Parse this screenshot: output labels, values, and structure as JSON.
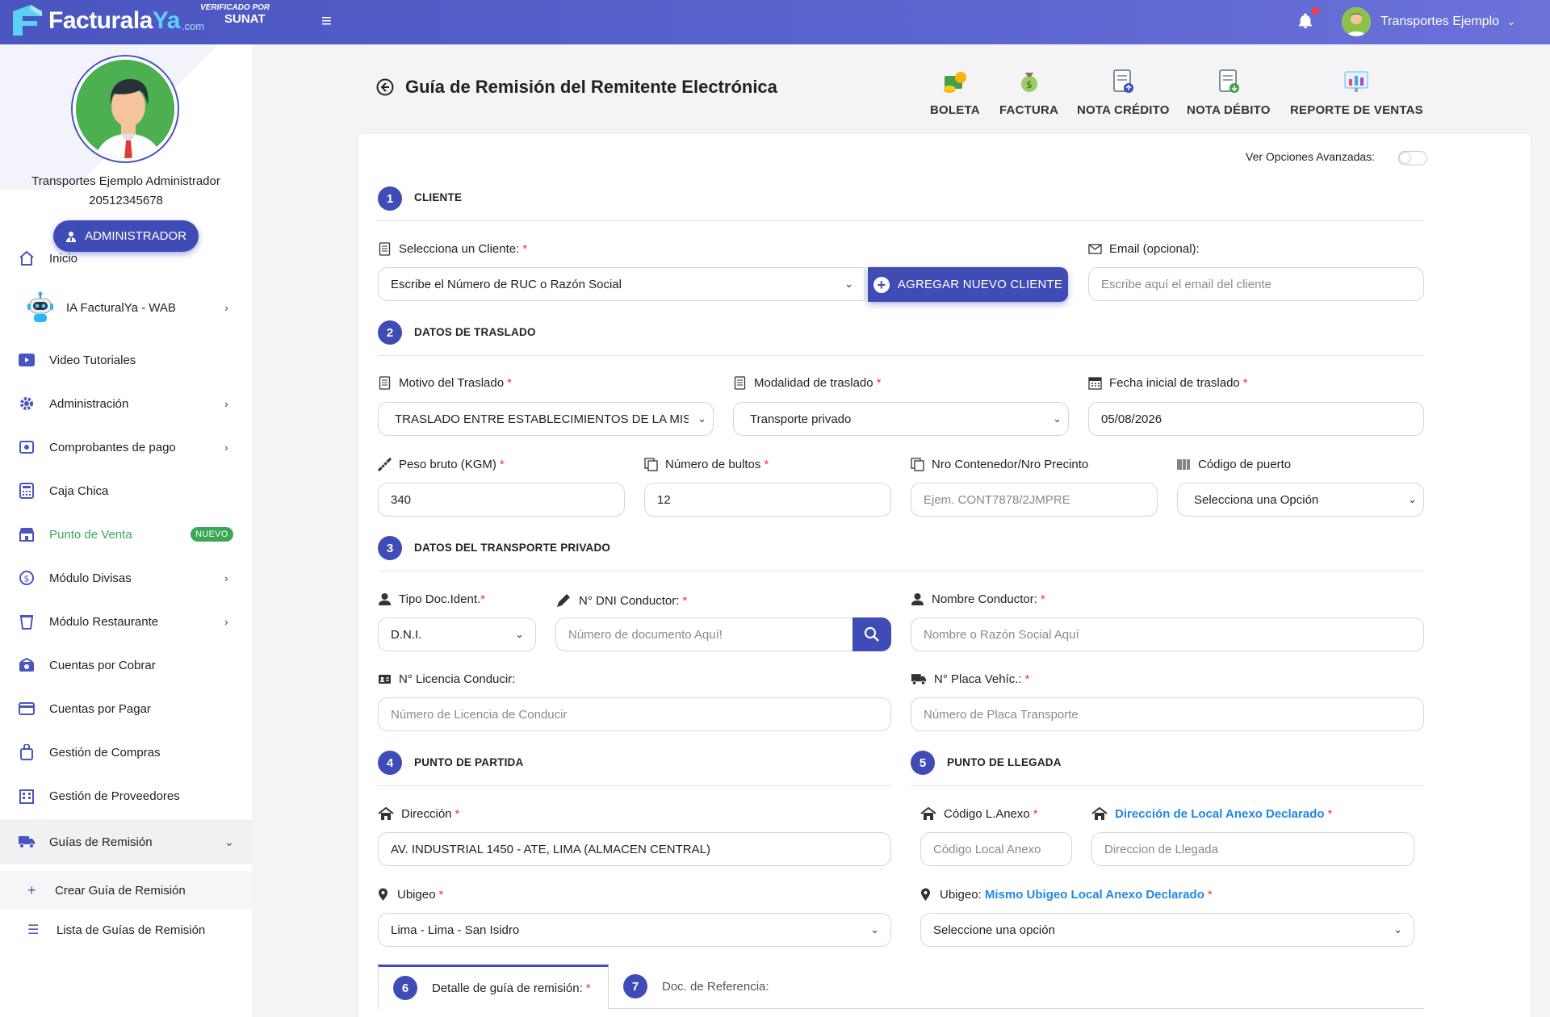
{
  "header": {
    "logo_main": "Facturala",
    "logo_ya": "Ya",
    "logo_com": ".com",
    "sunat_line1": "VERIFICADO POR",
    "sunat_line2": "SUNAT",
    "user_name": "Transportes Ejemplo"
  },
  "profile": {
    "name": "Transportes Ejemplo Administrador",
    "ruc": "20512345678",
    "role_button": "ADMINISTRADOR"
  },
  "sidebar": {
    "items": [
      {
        "label": "Inicio",
        "icon": "home-icon"
      },
      {
        "label": "IA FacturalYa - WAB",
        "icon": "robot-icon"
      },
      {
        "label": "Video Tutoriales",
        "icon": "video-icon"
      },
      {
        "label": "Administración",
        "icon": "gear-icon"
      },
      {
        "label": "Comprobantes de pago",
        "icon": "receipt-icon"
      },
      {
        "label": "Caja Chica",
        "icon": "calculator-icon"
      },
      {
        "label": "Punto de Venta",
        "icon": "store-icon",
        "badge": "NUEVO"
      },
      {
        "label": "Módulo Divisas",
        "icon": "currency-icon"
      },
      {
        "label": "Módulo Restaurante",
        "icon": "cup-icon"
      },
      {
        "label": "Cuentas por Cobrar",
        "icon": "cash-icon"
      },
      {
        "label": "Cuentas por Pagar",
        "icon": "card-icon"
      },
      {
        "label": "Gestión de Compras",
        "icon": "bag-icon"
      },
      {
        "label": "Gestión de Proveedores",
        "icon": "building-icon"
      },
      {
        "label": "Guías de Remisión",
        "icon": "truck-icon"
      }
    ],
    "sub_items": [
      {
        "label": "Crear Guía de Remisión",
        "icon": "plus-icon"
      },
      {
        "label": "Lista de Guías de Remisión",
        "icon": "list-icon"
      }
    ]
  },
  "page": {
    "title": "Guía de Remisión del Remitente Electrónica",
    "quick_links": [
      "BOLETA",
      "FACTURA",
      "NOTA CRÉDITO",
      "NOTA DÉBITO",
      "REPORTE DE VENTAS"
    ],
    "advanced_label": "Ver Opciones Avanzadas:"
  },
  "sections": {
    "s1": {
      "num": "1",
      "title": "CLIENTE"
    },
    "s2": {
      "num": "2",
      "title": "DATOS DE TRASLADO"
    },
    "s3": {
      "num": "3",
      "title": "DATOS DEL TRANSPORTE PRIVADO"
    },
    "s4": {
      "num": "4",
      "title": "PUNTO DE PARTIDA"
    },
    "s5": {
      "num": "5",
      "title": "PUNTO DE LLEGADA"
    }
  },
  "cliente": {
    "select_label": "Selecciona un Cliente:",
    "select_value": "Escribe el Número de RUC o Razón Social",
    "add_button": "AGREGAR NUEVO CLIENTE",
    "email_label": "Email (opcional):",
    "email_placeholder": "Escribe aquí el email del cliente"
  },
  "traslado": {
    "motivo_label": "Motivo del Traslado",
    "motivo_value": "TRASLADO ENTRE ESTABLECIMIENTOS DE LA MISMA EMPRESA",
    "modalidad_label": "Modalidad de traslado",
    "modalidad_value": "Transporte privado",
    "fecha_label": "Fecha inicial de traslado",
    "fecha_value": "05/08/2026",
    "peso_label": "Peso bruto (KGM)",
    "peso_value": "340",
    "bultos_label": "Número de bultos",
    "bultos_value": "12",
    "contenedor_label": "Nro Contenedor/Nro Precinto",
    "contenedor_placeholder": "Ejem. CONT7878/2JMPRE",
    "puerto_label": "Código de puerto",
    "puerto_value": "Selecciona una Opción"
  },
  "transporte": {
    "tipo_label": "Tipo Doc.Ident.",
    "tipo_value": "D.N.I.",
    "dni_label": "N° DNI Conductor:",
    "dni_placeholder": "Número de documento Aquí!",
    "nombre_label": "Nombre Conductor:",
    "nombre_placeholder": "Nombre o Razón Social Aquí",
    "licencia_label": "N° Licencia Conducir:",
    "licencia_placeholder": "Número de Licencia de Conducir",
    "placa_label": "N° Placa Vehíc.:",
    "placa_placeholder": "Número de Placa Transporte"
  },
  "partida": {
    "direccion_label": "Dirección",
    "direccion_value": "AV. INDUSTRIAL 1450 - ATE, LIMA (ALMACEN CENTRAL)",
    "ubigeo_label": "Ubigeo",
    "ubigeo_value": "Lima - Lima - San Isidro"
  },
  "llegada": {
    "codigo_label": "Código L.Anexo",
    "codigo_placeholder": "Código Local Anexo",
    "direccion_link": "Dirección de Local Anexo Declarado",
    "direccion_placeholder": "Direccion de Llegada",
    "ubigeo_label": "Ubigeo:",
    "ubigeo_link": "Mismo Ubigeo Local Anexo Declarado",
    "ubigeo_value": "Seleccione una opción"
  },
  "tabs": [
    {
      "num": "6",
      "label": "Detalle de guía de remisión:"
    },
    {
      "num": "7",
      "label": "Doc. de Referencia:"
    }
  ],
  "colors": {
    "primary": "#3f4cb6",
    "topbar": "#5b65d0",
    "required": "#e53935",
    "link": "#1e88e5",
    "badge": "#3aa755"
  }
}
